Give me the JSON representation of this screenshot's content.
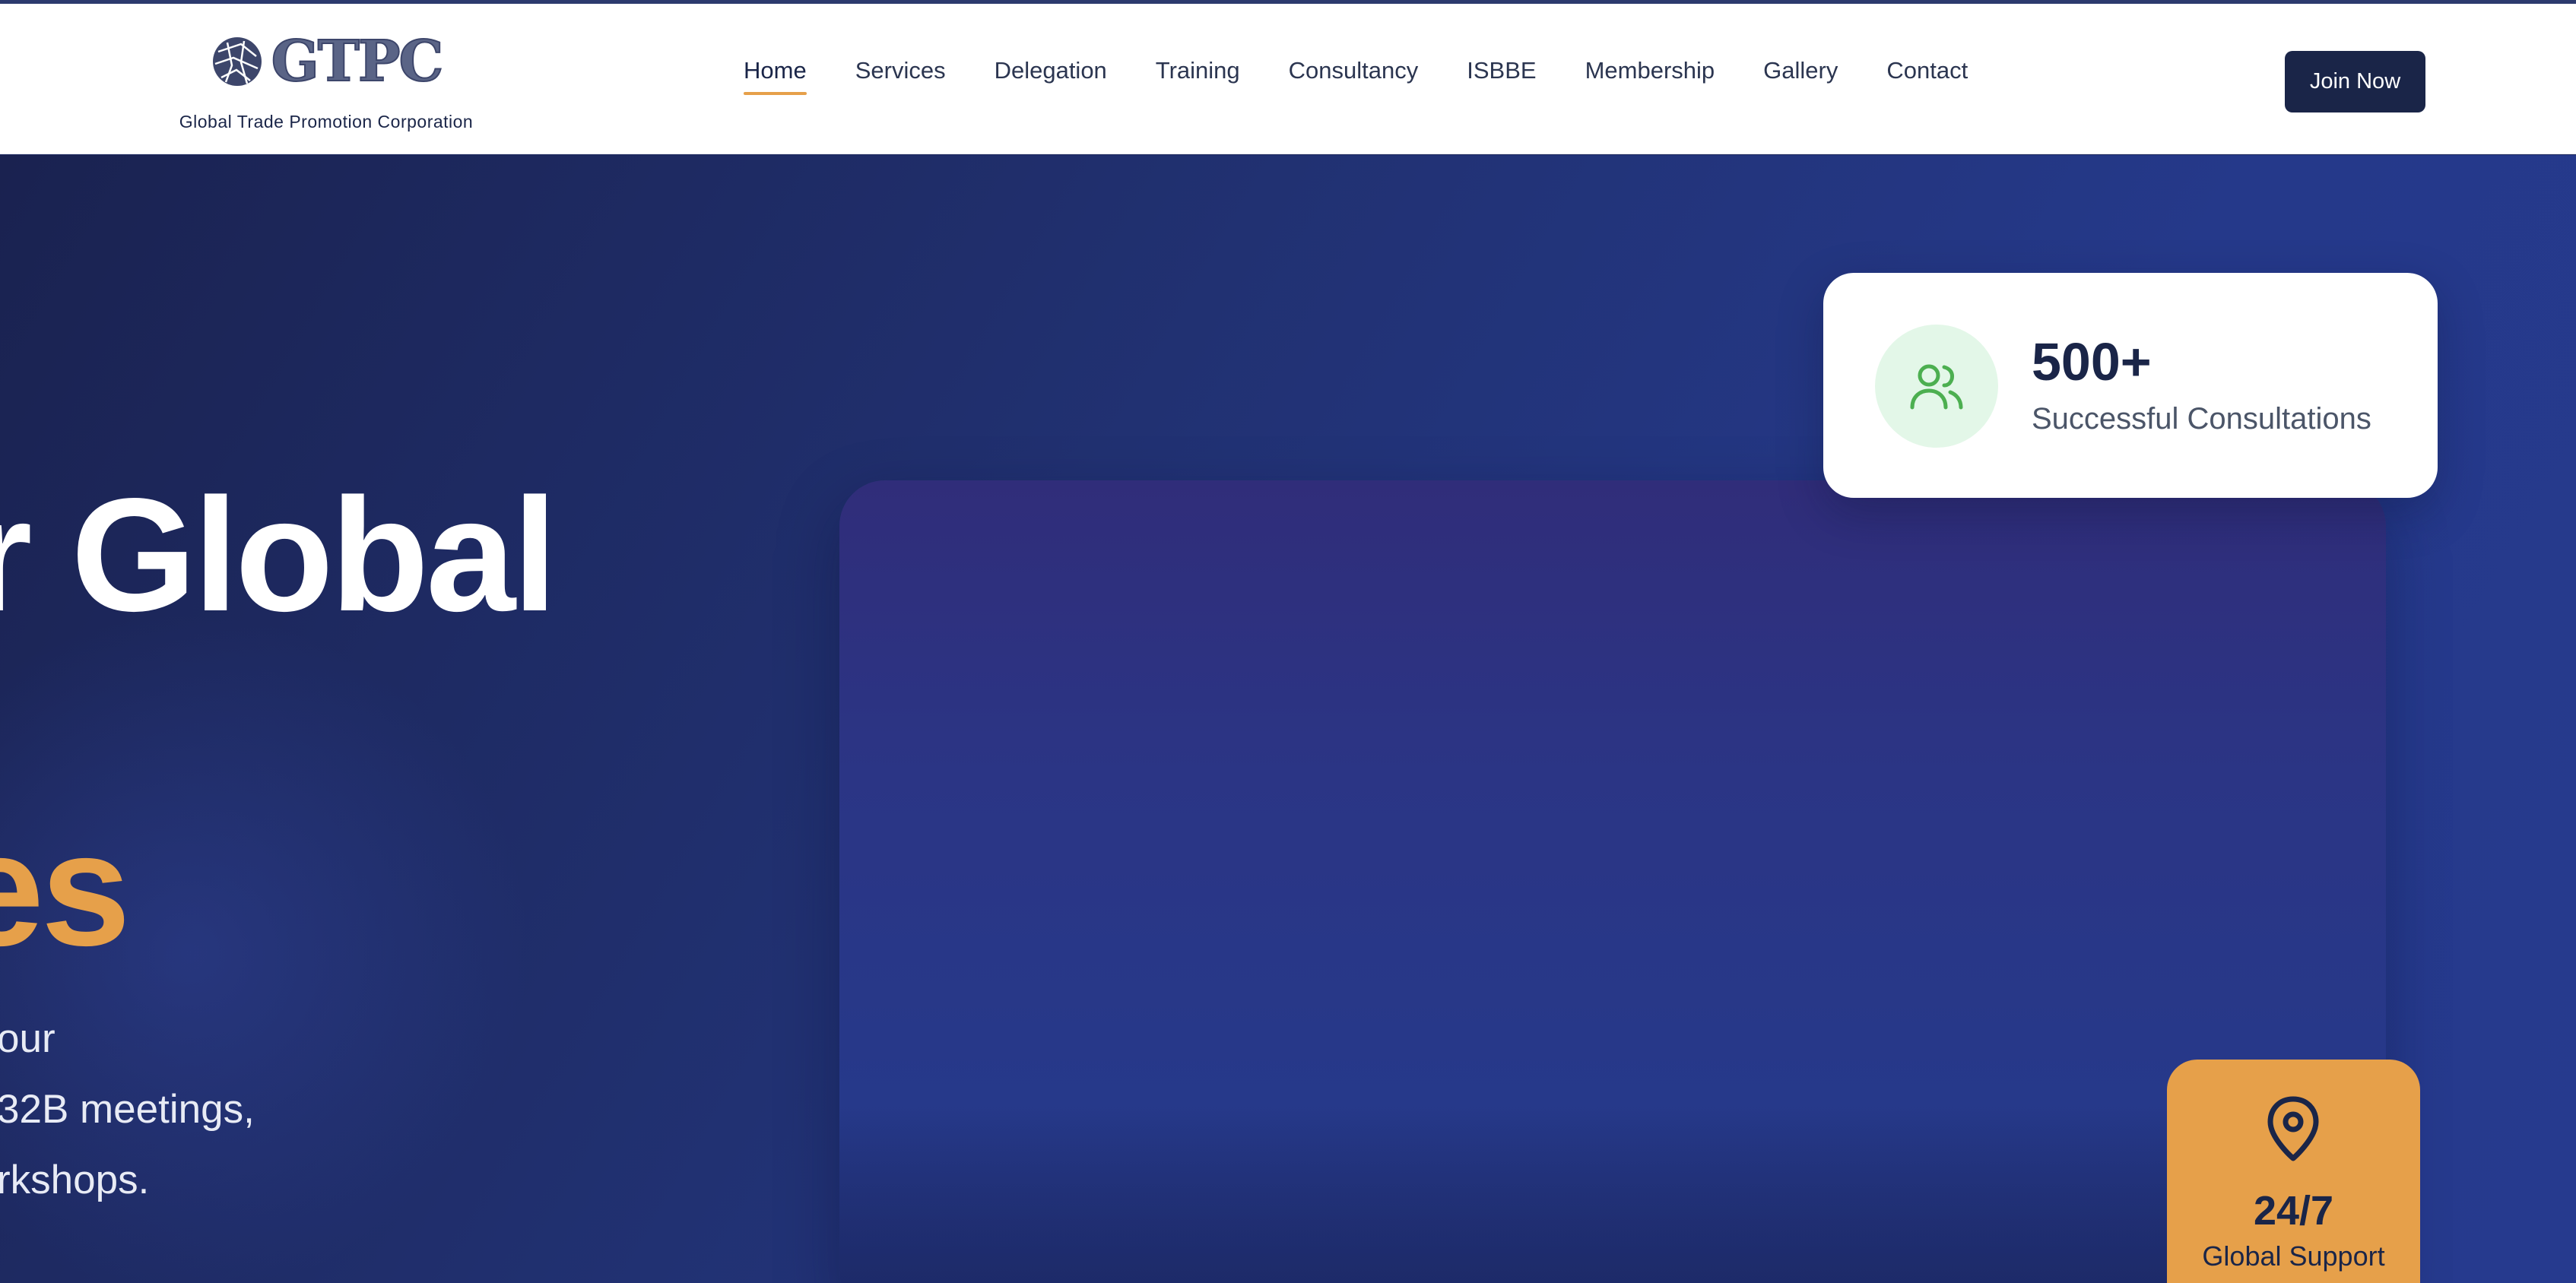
{
  "brand": {
    "logo_text": "GTPC",
    "subtitle": "Global Trade Promotion Corporation"
  },
  "nav": {
    "items": [
      {
        "label": "Home",
        "active": true
      },
      {
        "label": "Services"
      },
      {
        "label": "Delegation"
      },
      {
        "label": "Training"
      },
      {
        "label": "Consultancy"
      },
      {
        "label": "ISBBE"
      },
      {
        "label": "Membership"
      },
      {
        "label": "Gallery"
      },
      {
        "label": "Contact"
      }
    ],
    "cta": "Join Now"
  },
  "hero": {
    "headline_visible": "r Global",
    "headline_accent_visible": "es",
    "description_lines": [
      "our",
      "32B meetings,",
      "rkshops."
    ]
  },
  "stats": {
    "consultations": {
      "number": "500+",
      "label": "Successful Consultations",
      "icon": "users-icon"
    },
    "support": {
      "number": "24/7",
      "label": "Global Support",
      "icon": "map-pin-icon"
    }
  },
  "colors": {
    "brand_navy": "#1a2548",
    "accent_orange": "#e6a04a",
    "hero_blue": "#25398a",
    "icon_green": "#4caf50",
    "icon_green_bg": "#e3f7e8"
  }
}
